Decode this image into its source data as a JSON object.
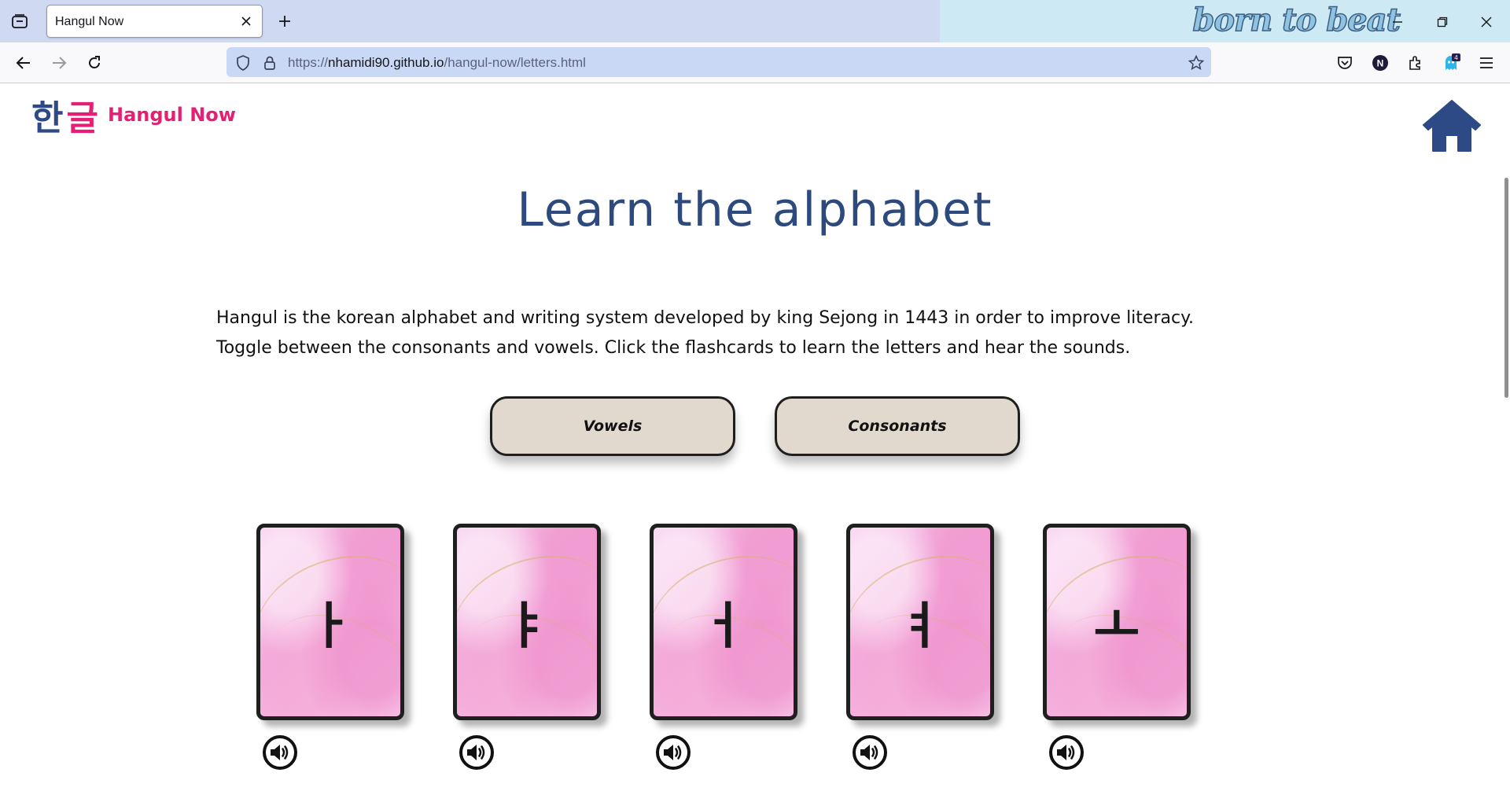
{
  "browser": {
    "tab_title": "Hangul Now",
    "theme_text": "born to beat",
    "url_prefix": "https://",
    "url_host": "nhamidi90.github.io",
    "url_path": "/hangul-now/letters.html",
    "extension_badge": "4",
    "profile_initial": "N"
  },
  "site": {
    "logo_char_1": "한",
    "logo_char_2": "글",
    "name": "Hangul Now"
  },
  "main": {
    "title": "Learn the alphabet",
    "intro": "Hangul is the korean alphabet and writing system developed by king Sejong in 1443 in order to improve literacy. Toggle between the consonants and vowels. Click the flashcards to learn the letters and hear the sounds.",
    "toggle_buttons": [
      "Vowels",
      "Consonants"
    ]
  },
  "flashcards": [
    {
      "letter": "ㅏ"
    },
    {
      "letter": "ㅑ"
    },
    {
      "letter": "ㅓ"
    },
    {
      "letter": "ㅕ"
    },
    {
      "letter": "ㅗ"
    }
  ],
  "colors": {
    "brand_pink": "#e41f74",
    "brand_navy": "#2d4a87",
    "button_beige": "#e1d9cd"
  },
  "icons": {
    "home": "home-icon",
    "sound": "speaker-icon"
  }
}
